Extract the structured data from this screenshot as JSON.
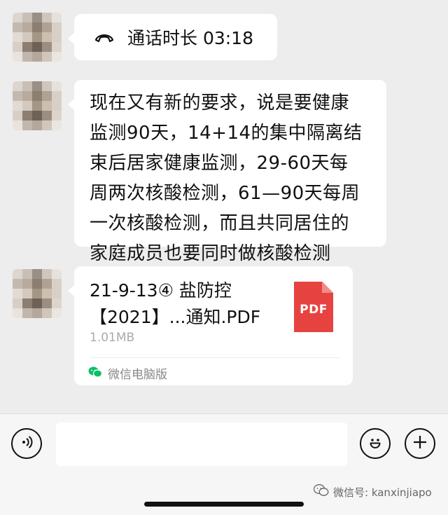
{
  "messages": {
    "call": {
      "text": "通话时长 03:18",
      "icon": "phone-hangup-icon"
    },
    "text_message": {
      "text": "现在又有新的要求，说是要健康\n监测90天，14+14的集中隔离结\n束后居家健康监测，29-60天每\n周两次核酸检测，61—90天每周\n一次核酸检测，而且共同居住的\n家庭成员也要同时做核酸检测"
    },
    "file_message": {
      "name": "21-9-13④ 盐防控\n【2021】...通知.PDF",
      "size": "1.01MB",
      "file_icon_label": "PDF",
      "source": "微信电脑版",
      "source_icon": "wechat-icon"
    }
  },
  "input_bar": {
    "input_value": "",
    "voice_icon": "voice-icon",
    "emoji_icon": "emoji-icon",
    "plus_icon": "plus-icon"
  },
  "watermark": "微信号: kanxinjiapo",
  "colors": {
    "chat_background": "#ededed",
    "bubble": "#ffffff",
    "pdf_red": "#e64340",
    "wechat_green": "#07c160"
  }
}
